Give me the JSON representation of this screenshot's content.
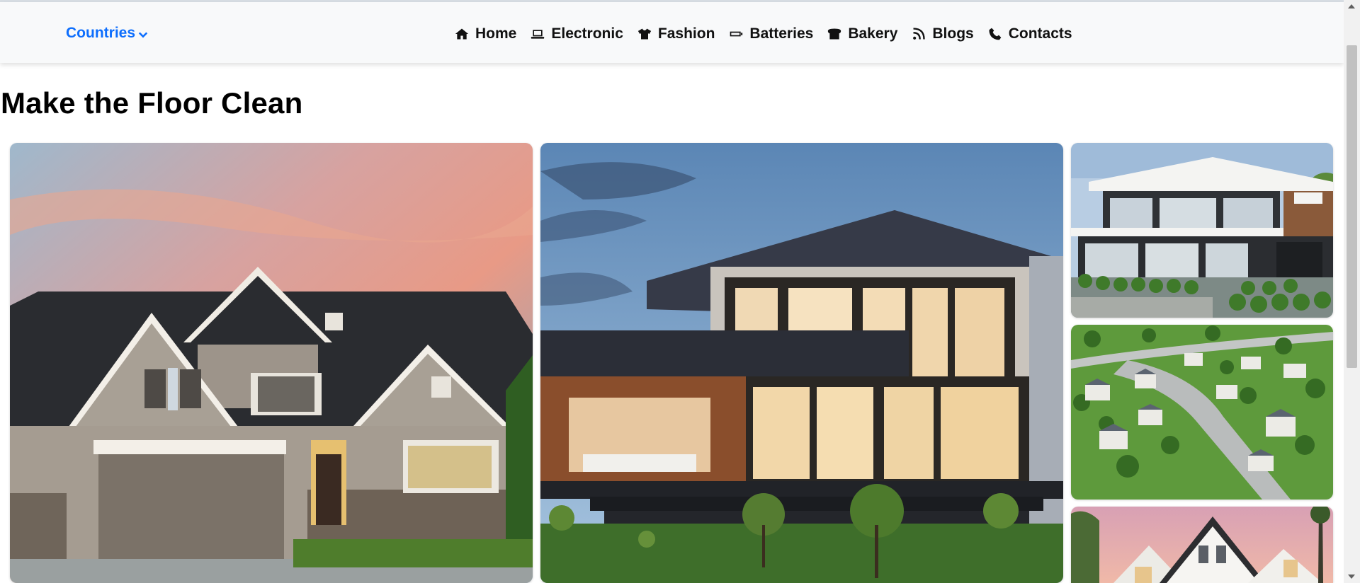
{
  "navbar": {
    "countries_label": "Countries",
    "links": [
      {
        "label": "Home",
        "icon": "home-icon"
      },
      {
        "label": "Electronic",
        "icon": "laptop-icon"
      },
      {
        "label": "Fashion",
        "icon": "tshirt-icon"
      },
      {
        "label": "Batteries",
        "icon": "battery-icon"
      },
      {
        "label": "Bakery",
        "icon": "bread-icon"
      },
      {
        "label": "Blogs",
        "icon": "feed-icon"
      },
      {
        "label": "Contacts",
        "icon": "phone-icon"
      }
    ],
    "accent_color": "#0d6efd"
  },
  "main": {
    "title": "Make the Floor Clean"
  }
}
